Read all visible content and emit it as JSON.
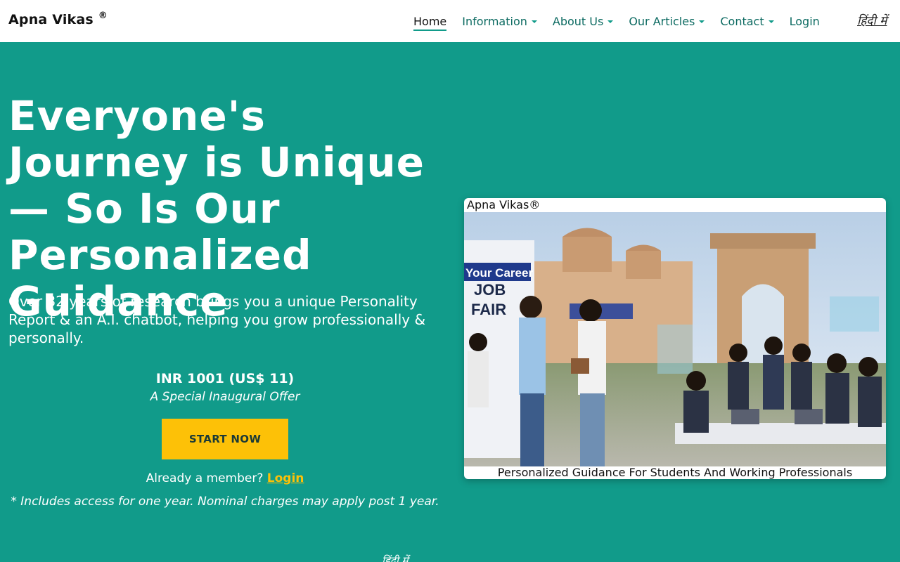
{
  "nav": {
    "brand": "Apna Vikas",
    "brand_mark": "®",
    "links": [
      {
        "label": "Home",
        "active": true,
        "dropdown": false
      },
      {
        "label": "Information",
        "active": false,
        "dropdown": true
      },
      {
        "label": "About Us",
        "active": false,
        "dropdown": true
      },
      {
        "label": "Our Articles",
        "active": false,
        "dropdown": true
      },
      {
        "label": "Contact",
        "active": false,
        "dropdown": true
      },
      {
        "label": "Login",
        "active": false,
        "dropdown": false
      }
    ],
    "hindi_link": "हिंदी में"
  },
  "hero": {
    "title": "Everyone's Journey is Unique — So Is Our Personalized Guidance",
    "subtitle": "Over 32 years of research brings you a unique Personality Report & an A.I. chatbot, helping you grow professionally & personally.",
    "price": "INR 1001 (US$ 11)",
    "offer": "A Special Inaugural Offer",
    "cta_label": "START NOW",
    "member_text": "Already a member?",
    "member_link": "Login",
    "note": "* Includes access for one year. Nominal charges may apply post 1 year.",
    "hindi_bottom": "हिंदी में"
  },
  "image_card": {
    "brand": "Apna Vikas®",
    "sign_text_1": "Your Career",
    "sign_text_2": "JOB",
    "sign_text_3": "FAIR",
    "caption": "Personalized Guidance For Students And Working Professionals"
  },
  "colors": {
    "brand_teal": "#119b8a",
    "cta_yellow": "#fdc107",
    "nav_bg": "#ffffff"
  }
}
